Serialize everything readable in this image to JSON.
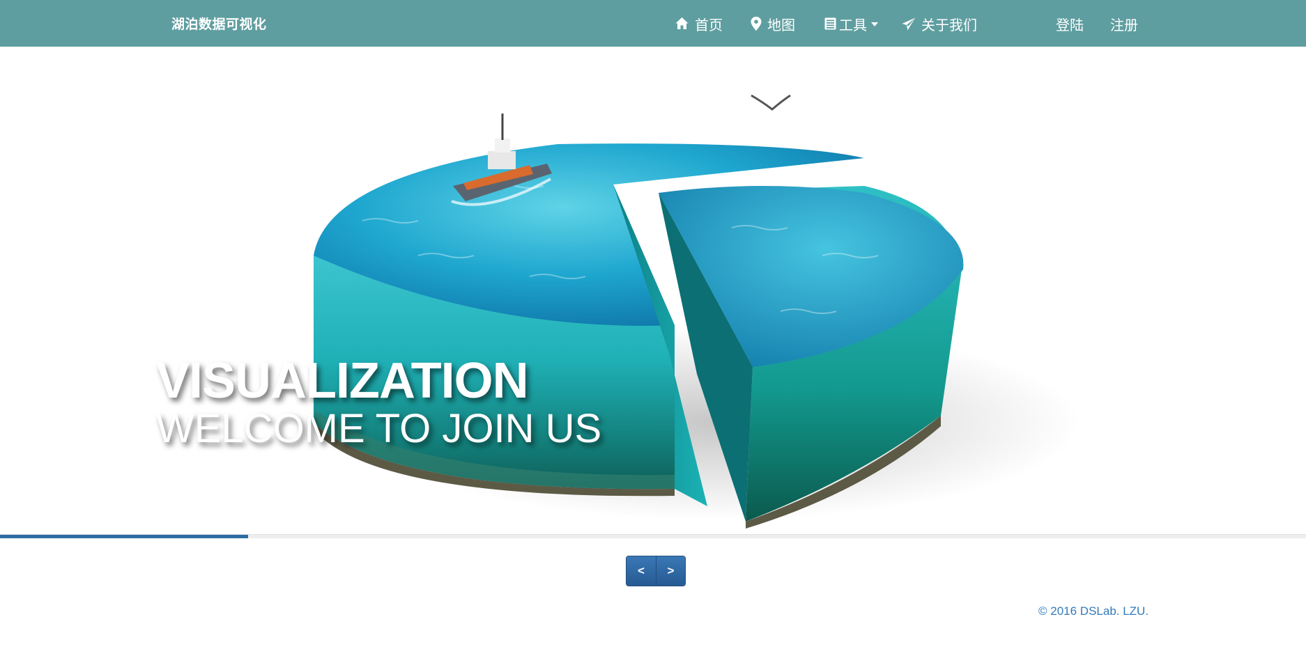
{
  "navbar": {
    "brand": "湖泊数据可视化",
    "items": [
      {
        "label": "首页",
        "icon": "home-icon"
      },
      {
        "label": "地图",
        "icon": "map-marker-icon"
      },
      {
        "label": "工具",
        "icon": "list-icon",
        "dropdown": true
      },
      {
        "label": "关于我们",
        "icon": "send-icon"
      }
    ],
    "auth": {
      "login": "登陆",
      "register": "注册"
    }
  },
  "hero": {
    "title": "VISUALIZATION",
    "subtitle": "WELCOME TO JOIN US",
    "image_description_icon": "water-pie-chart-illustration"
  },
  "carousel": {
    "progress_fraction": 0.19,
    "prev_label": "<",
    "next_label": ">"
  },
  "footer": {
    "copyright": "© 2016 DSLab. LZU."
  },
  "colors": {
    "navbar_bg": "#5f9ea0",
    "accent": "#2e6da4",
    "footer_text": "#337ab7"
  }
}
